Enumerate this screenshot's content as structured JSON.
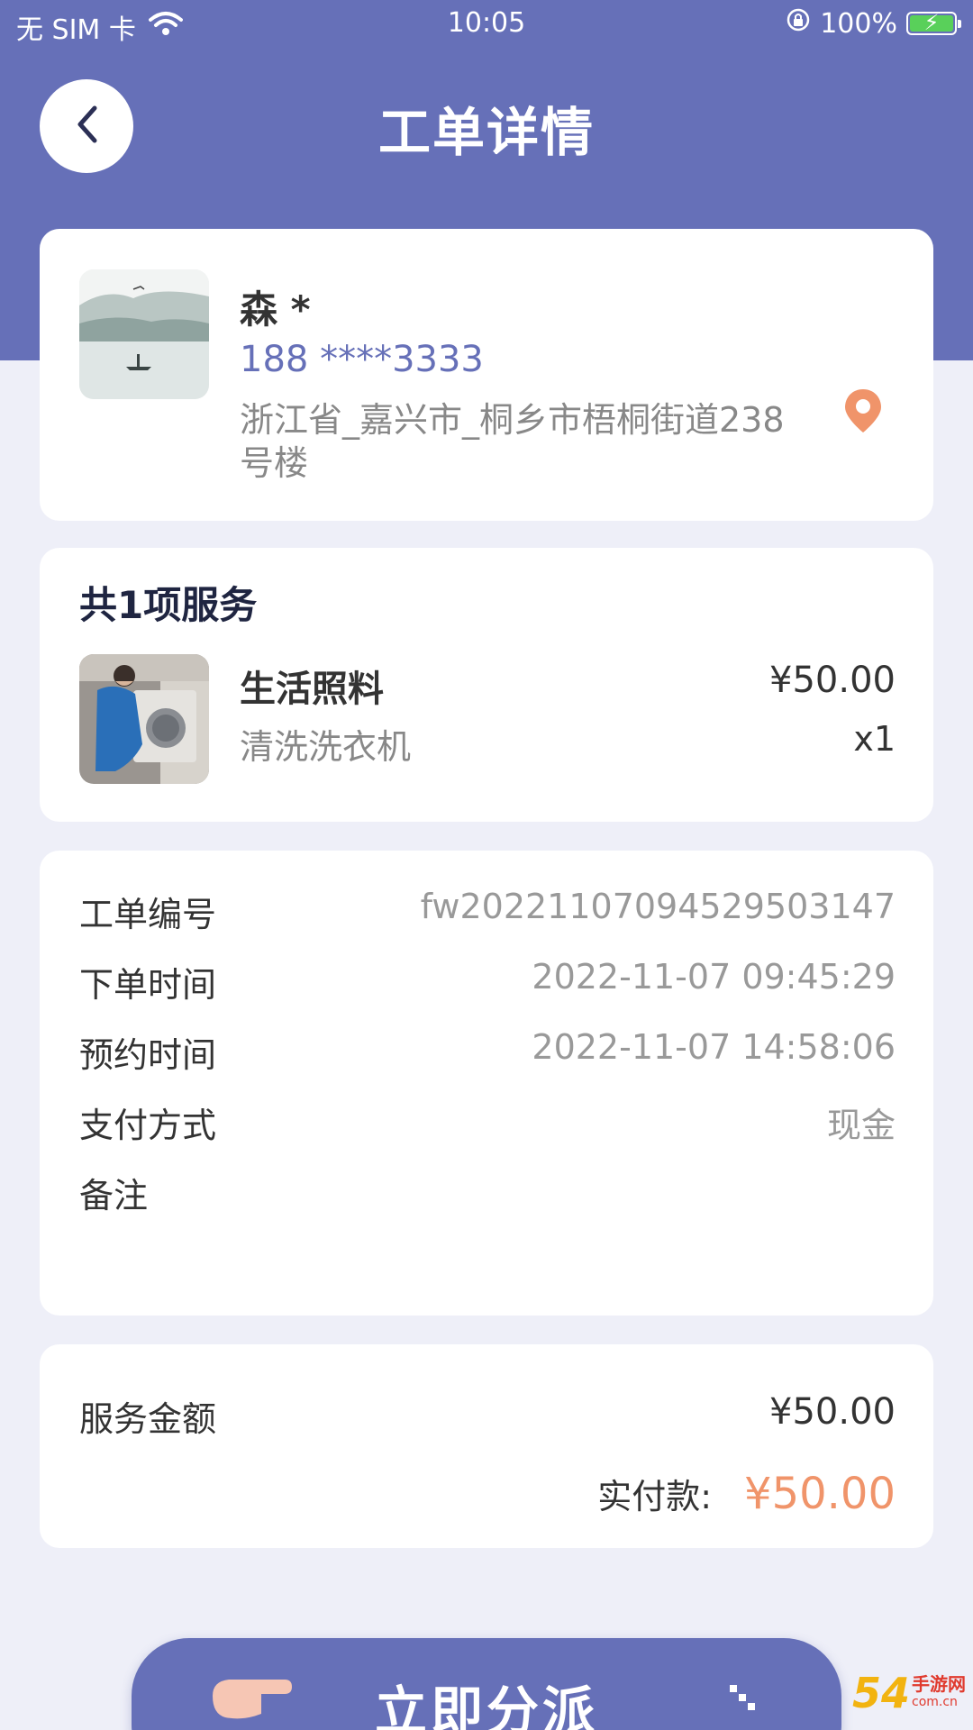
{
  "status_bar": {
    "carrier": "无 SIM 卡",
    "time": "10:05",
    "battery": "100%"
  },
  "nav": {
    "title": "工单详情"
  },
  "customer": {
    "name": "森 *",
    "phone": "188 ****3333",
    "address": "浙江省_嘉兴市_桐乡市梧桐街道238号楼"
  },
  "service": {
    "title": "共1项服务",
    "items": [
      {
        "name": "生活照料",
        "description": "清洗洗衣机",
        "price": "¥50.00",
        "quantity": "x1"
      }
    ]
  },
  "order_info": {
    "rows": [
      {
        "label": "工单编号",
        "value": "fw20221107094529503147"
      },
      {
        "label": "下单时间",
        "value": "2022-11-07 09:45:29"
      },
      {
        "label": "预约时间",
        "value": "2022-11-07 14:58:06"
      },
      {
        "label": "支付方式",
        "value": "现金"
      },
      {
        "label": "备注",
        "value": ""
      }
    ]
  },
  "amount": {
    "service_amount_label": "服务金额",
    "service_amount": "¥50.00",
    "paid_label": "实付款:",
    "paid_value": "¥50.00"
  },
  "action": {
    "assign_label": "立即分派"
  },
  "watermark": {
    "number": "54",
    "text": "手游网",
    "domain": "com.cn"
  },
  "colors": {
    "header": "#6670b8",
    "background": "#eeeff8",
    "accent_price": "#f0946a",
    "pin": "#f0946a"
  }
}
